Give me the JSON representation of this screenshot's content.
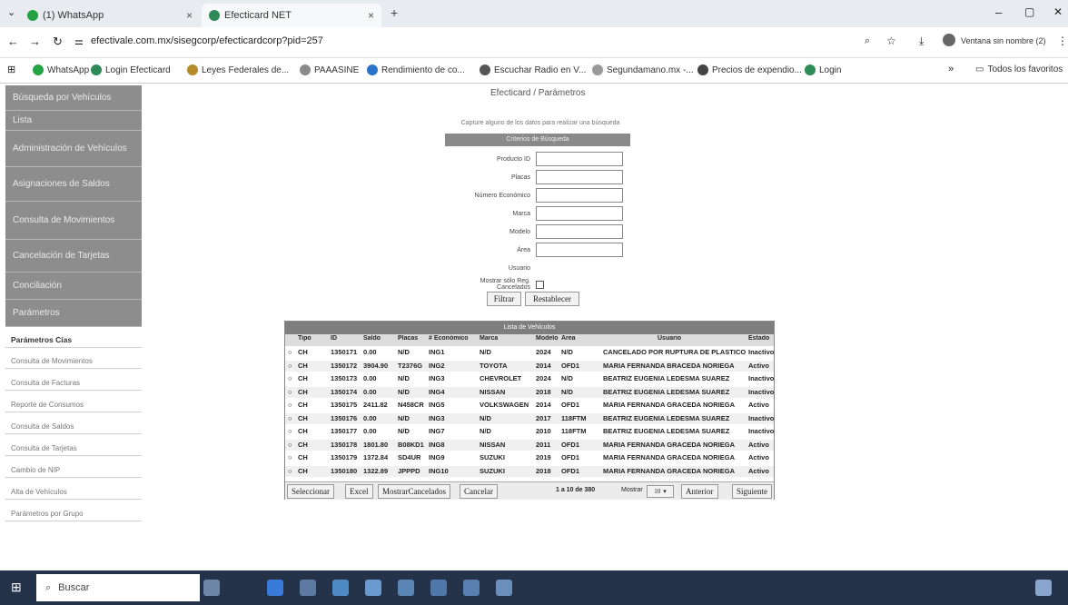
{
  "browser": {
    "tabs": [
      {
        "label": "(1) WhatsApp",
        "close": "×"
      },
      {
        "label": "Efecticard NET",
        "close": "×"
      }
    ],
    "new_tab": "+",
    "url": "efectivale.com.mx/sisegcorp/efecticardcorp?pid=257",
    "profile_label": "Ventana sin nombre (2)",
    "bookmarks": [
      "WhatsApp",
      "Login Efecticard",
      "Leyes Federales de...",
      "PAAASINE",
      "Rendimiento de co...",
      "Escuchar Radio en V...",
      "Segundamano.mx -...",
      "Precios de expendio...",
      "Login"
    ],
    "bookmarks_overflow": "»",
    "all_bookmarks": "Todos los favoritos"
  },
  "sidebar": {
    "items": [
      "Búsqueda por Vehículos",
      "Lista",
      "Administración de Vehículos",
      "Asignaciones de Saldos",
      "Consulta de Movimientos",
      "Cancelación de Tarjetas",
      "Conciliación",
      "Parámetros"
    ],
    "subitems": [
      "Parámetros Cías",
      "Consulta de Movimientos",
      "Consulta de Facturas",
      "Reporte de Consumos",
      "Consulta de Saldos",
      "Consulta de Tarjetas",
      "Cambio de NIP",
      "Alta de Vehículos",
      "Parámetros por Grupo"
    ]
  },
  "main": {
    "title": "Efecticard / Parámetros",
    "hint": "Capture alguno de los datos para realizar una búsqueda",
    "filter_header": "Criterios de Búsqueda",
    "filter_fields": [
      {
        "label": "Producto ID"
      },
      {
        "label": "Placas"
      },
      {
        "label": "Número Económico"
      },
      {
        "label": "Marca"
      },
      {
        "label": "Modelo"
      },
      {
        "label": "Área"
      },
      {
        "label": "Usuario"
      }
    ],
    "checkbox_label": "Mostrar sólo Reg. Cancelados",
    "buttons": {
      "filter": "Filtrar",
      "reset": "Restablecer"
    },
    "grid": {
      "title": "Lista de Vehículos",
      "columns": [
        "Tipo",
        "ID",
        "Saldo",
        "Placas",
        "# Económico",
        "Marca",
        "Modelo",
        "Área",
        "Usuario",
        "Estado"
      ],
      "rows": [
        [
          "CH",
          "1350171",
          "0.00",
          "N/D",
          "ING1",
          "N/D",
          "2024",
          "N/D",
          "CANCELADO POR RUPTURA DE PLASTICO",
          "Inactivo"
        ],
        [
          "CH",
          "1350172",
          "3904.90",
          "T2376G",
          "ING2",
          "TOYOTA",
          "2014",
          "OFD1",
          "MARIA FERNANDA BRACEDA NORIEGA",
          "Activo"
        ],
        [
          "CH",
          "1350173",
          "0.00",
          "N/D",
          "ING3",
          "CHEVROLET",
          "2024",
          "N/D",
          "BEATRIZ EUGENIA LEDESMA SUAREZ",
          "Inactivo"
        ],
        [
          "CH",
          "1350174",
          "0.00",
          "N/D",
          "ING4",
          "NISSAN",
          "2018",
          "N/D",
          "BEATRIZ EUGENIA LEDESMA SUAREZ",
          "Inactivo"
        ],
        [
          "CH",
          "1350175",
          "2411.82",
          "N458CR",
          "ING5",
          "VOLKSWAGEN",
          "2014",
          "OFD1",
          "MARIA FERNANDA GRACEDA NORIEGA",
          "Activo"
        ],
        [
          "CH",
          "1350176",
          "0.00",
          "N/D",
          "ING3",
          "N/D",
          "2017",
          "118FTM",
          "BEATRIZ EUGENIA LEDESMA SUAREZ",
          "Inactivo"
        ],
        [
          "CH",
          "1350177",
          "0.00",
          "N/D",
          "ING7",
          "N/D",
          "2010",
          "118FTM",
          "BEATRIZ EUGENIA LEDESMA SUAREZ",
          "Inactivo"
        ],
        [
          "CH",
          "1350178",
          "1801.80",
          "B08KD1",
          "ING8",
          "NISSAN",
          "2011",
          "OFD1",
          "MARIA FERNANDA GRACEDA NORIEGA",
          "Activo"
        ],
        [
          "CH",
          "1350179",
          "1372.84",
          "SD4UR",
          "ING9",
          "SUZUKI",
          "2019",
          "OFD1",
          "MARIA FERNANDA GRACEDA NORIEGA",
          "Activo"
        ],
        [
          "CH",
          "1350180",
          "1322.89",
          "JPPPD",
          "ING10",
          "SUZUKI",
          "2018",
          "OFD1",
          "MARIA FERNANDA GRACEDA NORIEGA",
          "Activo"
        ]
      ],
      "footer_buttons": [
        "Seleccionar",
        "Excel",
        "MostrarCancelados",
        "Cancelar"
      ],
      "paging": "1 a 10 de 380",
      "show_label": "Mostrar",
      "page_size": "10",
      "prev": "Anterior",
      "next": "Siguiente"
    }
  },
  "taskbar": {
    "search": "Buscar"
  },
  "colors": {
    "sidebar_item": "#8d8d8d",
    "grid_header": "#7e7e7e",
    "taskbar": "#24324a"
  }
}
